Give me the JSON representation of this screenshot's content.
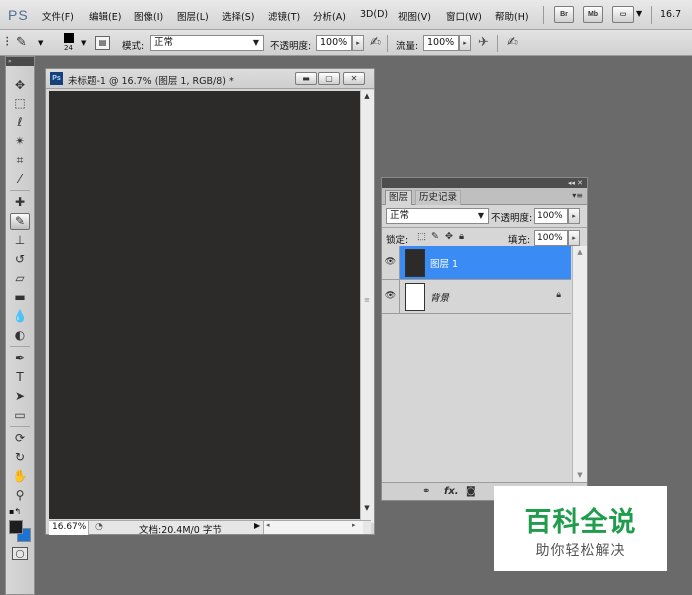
{
  "app": {
    "logo": "PS"
  },
  "menu": {
    "items": [
      "文件(F)",
      "编辑(E)",
      "图像(I)",
      "图层(L)",
      "选择(S)",
      "滤镜(T)",
      "分析(A)",
      "3D(D)",
      "视图(V)",
      "窗口(W)",
      "帮助(H)"
    ],
    "buttons": [
      "Br",
      "Mb"
    ],
    "zoom": "16.7"
  },
  "options": {
    "brush_size": "24",
    "mode_label": "模式:",
    "mode_value": "正常",
    "opacity_label": "不透明度:",
    "opacity_value": "100%",
    "flow_label": "流量:",
    "flow_value": "100%"
  },
  "document": {
    "title": "未标题-1 @ 16.7% (图层 1, RGB/8) *",
    "canvas_color": "#2d2b2a",
    "zoom": "16.67%",
    "info": "文档:20.4M/0 字节"
  },
  "layers_panel": {
    "tabs": [
      "图层",
      "历史记录"
    ],
    "blend_mode": "正常",
    "opacity_label": "不透明度:",
    "opacity_value": "100%",
    "lock_label": "锁定:",
    "fill_label": "填充:",
    "fill_value": "100%",
    "layers": [
      {
        "name": "图层 1",
        "selected": true,
        "thumb": "#2d2b2a"
      },
      {
        "name": "背景",
        "selected": false,
        "thumb": "#ffffff",
        "locked": true
      }
    ],
    "selection_color": "#3a8bf4"
  },
  "watermark": {
    "title": "百科全说",
    "subtitle": "助你轻松解决",
    "color": "#1f9c4c"
  }
}
